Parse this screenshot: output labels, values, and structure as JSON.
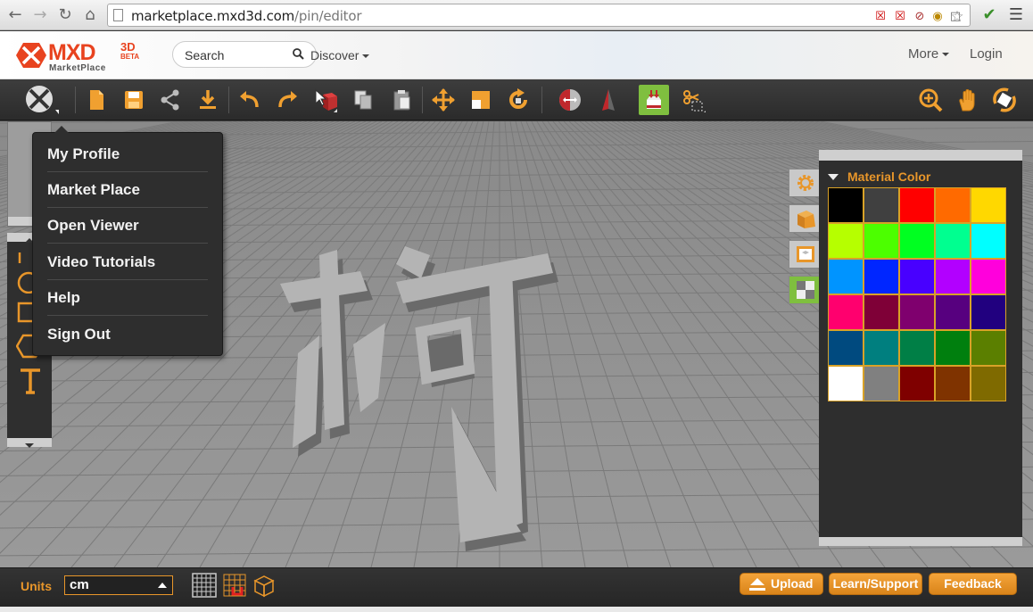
{
  "browser": {
    "url_host": "marketplace.mxd3d.com",
    "url_path": "/pin/editor"
  },
  "header": {
    "logo_text": "MXD",
    "logo_3d": "3D",
    "logo_beta": "BETA",
    "logo_sub": "MarketPlace",
    "search_placeholder": "Search",
    "discover_label": "Discover",
    "more_label": "More",
    "login_label": "Login"
  },
  "dropdown": {
    "items": [
      "My Profile",
      "Market Place",
      "Open Viewer",
      "Video Tutorials",
      "Help",
      "Sign Out"
    ]
  },
  "material_panel": {
    "title": "Material Color",
    "swatches": [
      "#000000",
      "#404040",
      "#ff0000",
      "#ff6a00",
      "#ffd800",
      "#b6ff00",
      "#4cff00",
      "#00ff21",
      "#00ff90",
      "#00ffff",
      "#0094ff",
      "#0026ff",
      "#4800ff",
      "#b200ff",
      "#ff00dc",
      "#ff006e",
      "#7f0037",
      "#7f006e",
      "#57007f",
      "#21007f",
      "#004a7f",
      "#007f7f",
      "#007f46",
      "#007f0e",
      "#5b7f00",
      "#ffffff",
      "#808080",
      "#7f0000",
      "#7f3300",
      "#7f6a00"
    ]
  },
  "bottom_bar": {
    "units_label": "Units",
    "units_value": "cm",
    "upload_label": "Upload",
    "learn_label": "Learn/Support",
    "feedback_label": "Feedback"
  },
  "colors": {
    "accent": "#e8962a",
    "active_green": "#7fbf3f",
    "brand_red": "#e8431f"
  }
}
